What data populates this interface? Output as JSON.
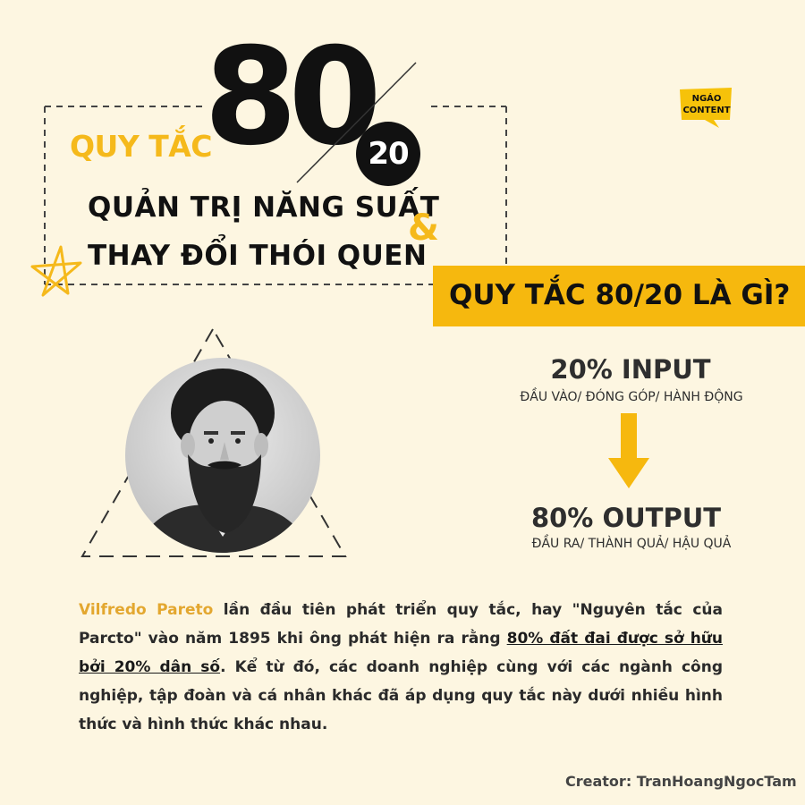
{
  "header": {
    "rule_label": "QUY TẮC",
    "big_number": "80",
    "small_number": "20",
    "subtitle_line1": "QUẢN TRỊ NĂNG SUẤT",
    "subtitle_line2": "THAY ĐỔI THÓI QUEN",
    "ampersand": "&"
  },
  "logo": {
    "line1": "NGÁO",
    "line2": "CONTENT"
  },
  "question": {
    "text": "QUY TẮC 80/20 LÀ GÌ?"
  },
  "input": {
    "title": "20% INPUT",
    "subtitle": "ĐẦU VÀO/ ĐÓNG GÓP/ HÀNH ĐỘNG"
  },
  "output": {
    "title": "80% OUTPUT",
    "subtitle": "ĐẦU RA/ THÀNH QUẢ/ HẬU QUẢ"
  },
  "paragraph": {
    "name": "Vilfredo Pareto",
    "part1": " lần đầu tiên phát triển quy tắc, hay \"Nguyên tắc của Parcto\" vào năm 1895 khi ông phát hiện ra rằng ",
    "underlined": "80% đất đai được sở hữu bởi 20% dân số",
    "part2": ".  Kể từ đó, các doanh nghiệp cùng với các ngành công nghiệp, tập đoàn và cá nhân khác đã áp dụng quy tắc này dưới nhiều hình thức và hình thức khác nhau."
  },
  "credit": "Creator: TranHoangNgocTam",
  "colors": {
    "background": "#fdf6e1",
    "accent": "#f6b80e",
    "dark": "#111111"
  }
}
